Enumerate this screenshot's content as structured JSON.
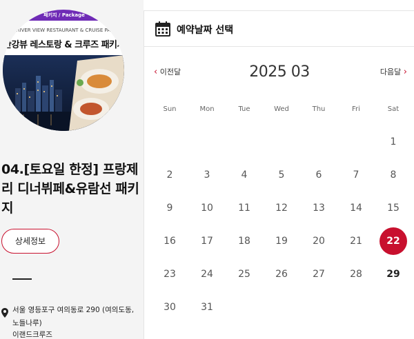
{
  "product": {
    "thumb_badge": "패키지 / Package",
    "thumb_english": "HAN RIVER VIEW RESTAURANT & CRUISE PACKAGE",
    "thumb_title": "한강뷰 레스토랑 & 크루즈 패키지",
    "title": "04.[토요일 한정] 프랑제리 디너뷔페&유람선 패키지",
    "detail_button": "상세정보",
    "address": "서울 영등포구 여의동로 290 (여의도동, 노들나루)",
    "company": "이랜드크루즈"
  },
  "calendar": {
    "header_title": "예약날짜 선택",
    "prev_label": "이전달",
    "next_label": "다음달",
    "month_label": "2025 03",
    "weekdays": [
      "Sun",
      "Mon",
      "Tue",
      "Wed",
      "Thu",
      "Fri",
      "Sat"
    ],
    "weeks": [
      [
        "",
        "",
        "",
        "",
        "",
        "",
        "1"
      ],
      [
        "2",
        "3",
        "4",
        "5",
        "6",
        "7",
        "8"
      ],
      [
        "9",
        "10",
        "11",
        "12",
        "13",
        "14",
        "15"
      ],
      [
        "16",
        "17",
        "18",
        "19",
        "20",
        "21",
        "22"
      ],
      [
        "23",
        "24",
        "25",
        "26",
        "27",
        "28",
        "29"
      ],
      [
        "30",
        "31",
        "",
        "",
        "",
        "",
        ""
      ]
    ],
    "selected_day": "22",
    "available_days": [
      "29"
    ]
  },
  "colors": {
    "accent": "#c8102e",
    "badge": "#6f2bb6"
  },
  "icons": {
    "calendar": "calendar-icon",
    "prev": "chevron-left-icon",
    "next": "chevron-right-icon",
    "location": "location-pin-icon"
  }
}
